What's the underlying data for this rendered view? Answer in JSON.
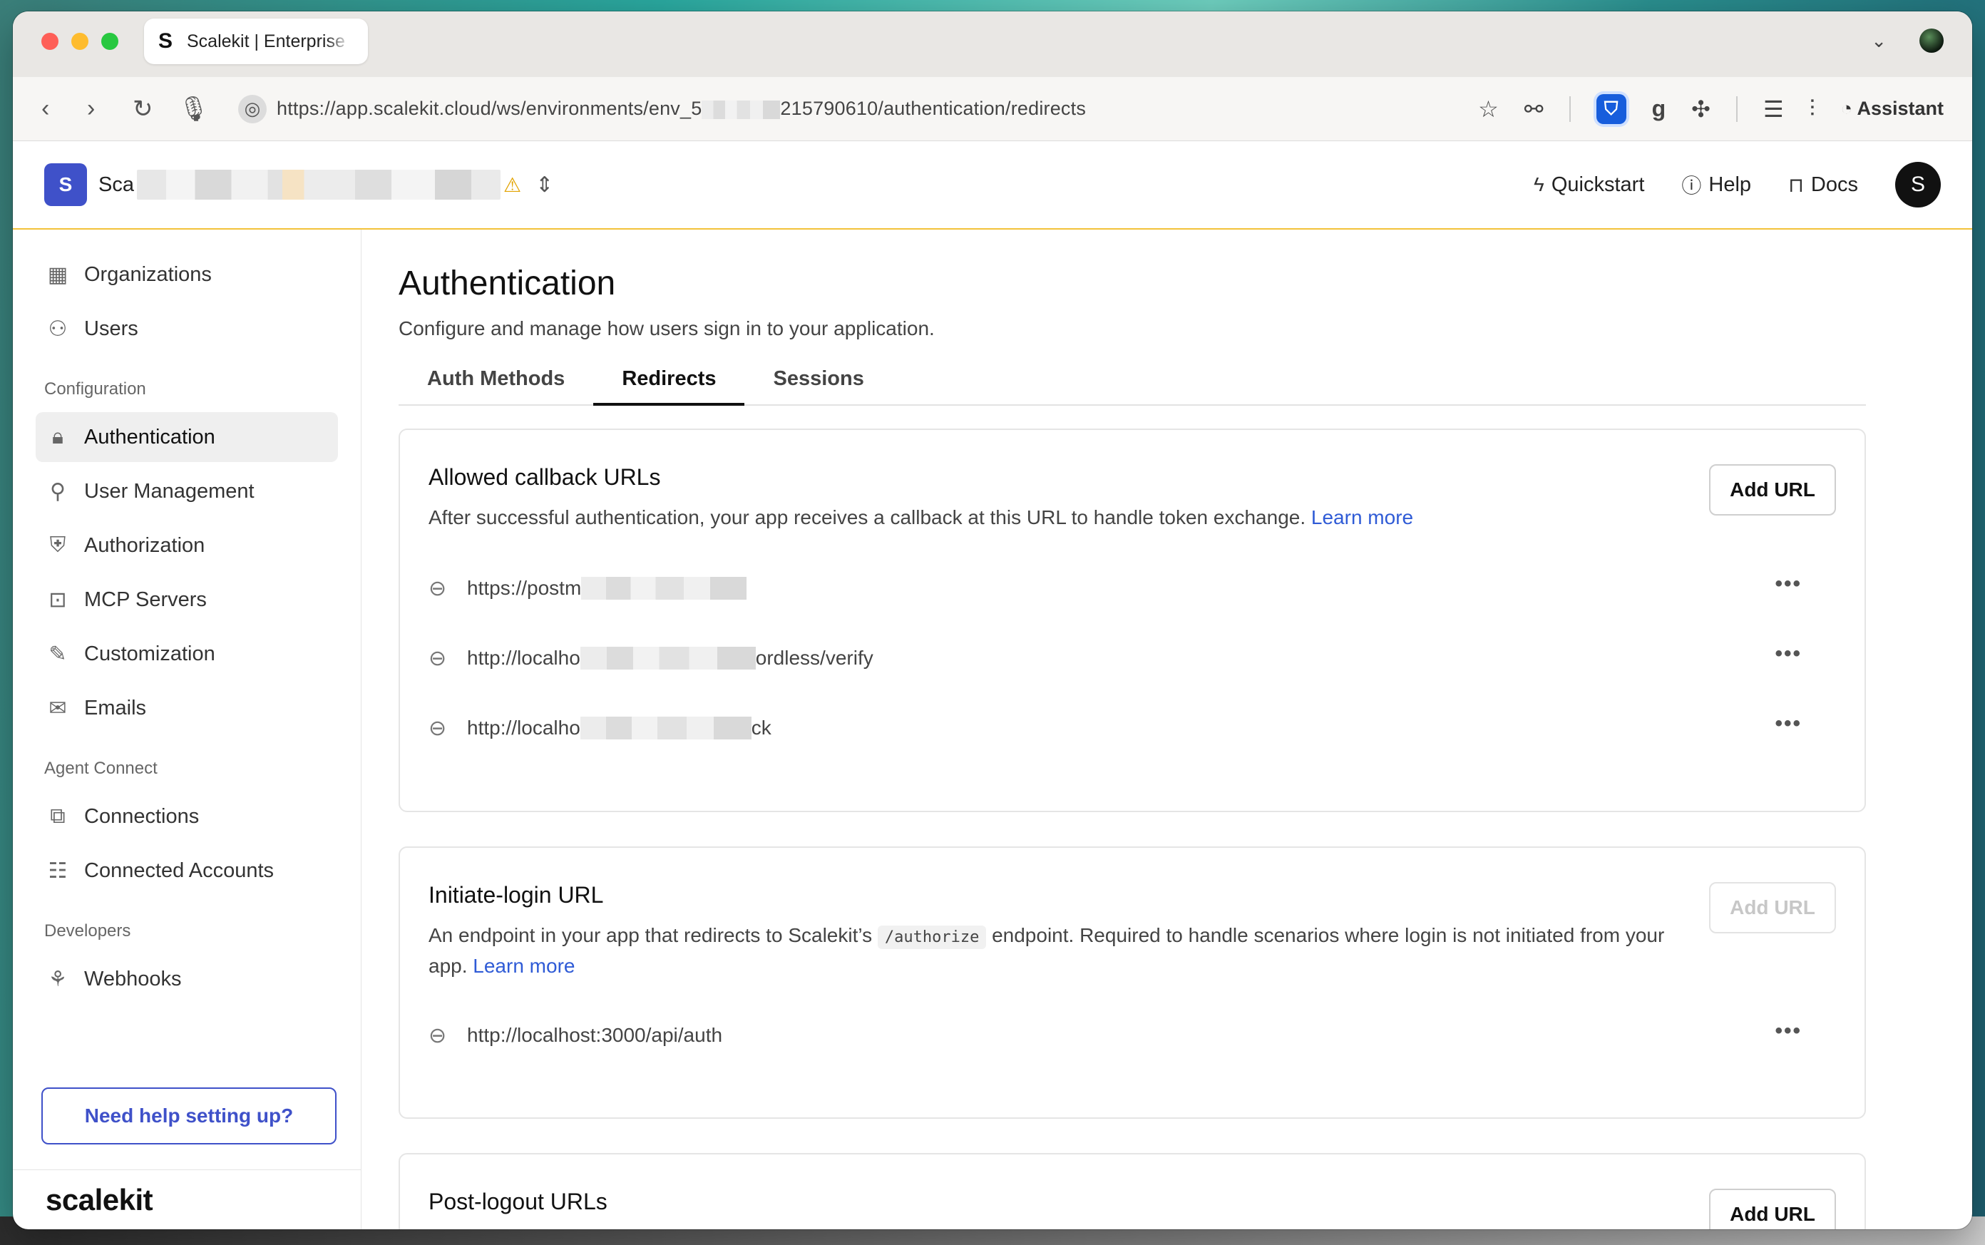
{
  "browser": {
    "tab_title": "Scalekit | Enterprise",
    "tab_favicon": "S",
    "url": "https://app.scalekit.cloud/ws/environments/env_5",
    "url_tail": "215790610/authentication/redirects",
    "assistant_label": "Assistant"
  },
  "header": {
    "workspace_initial": "S",
    "workspace_name": "Sca",
    "links": [
      {
        "label": "Quickstart",
        "icon": "bolt-icon"
      },
      {
        "label": "Help",
        "icon": "help-circle-icon"
      },
      {
        "label": "Docs",
        "icon": "book-icon"
      }
    ],
    "user_initial": "S"
  },
  "sidebar": {
    "items_top": [
      {
        "label": "Organizations",
        "icon": "building-icon"
      },
      {
        "label": "Users",
        "icon": "users-icon"
      }
    ],
    "section_config": "Configuration",
    "items_config": [
      {
        "label": "Authentication",
        "icon": "lock-icon"
      },
      {
        "label": "User Management",
        "icon": "user-settings-icon"
      },
      {
        "label": "Authorization",
        "icon": "shield-check-icon"
      },
      {
        "label": "MCP Servers",
        "icon": "robot-icon"
      },
      {
        "label": "Customization",
        "icon": "brush-icon"
      },
      {
        "label": "Emails",
        "icon": "mail-icon"
      }
    ],
    "section_agent": "Agent Connect",
    "items_agent": [
      {
        "label": "Connections",
        "icon": "blocks-icon"
      },
      {
        "label": "Connected Accounts",
        "icon": "accounts-icon"
      }
    ],
    "section_dev": "Developers",
    "items_dev": [
      {
        "label": "Webhooks",
        "icon": "webhook-icon"
      }
    ],
    "help_button": "Need help setting up?",
    "brand": "scalekit"
  },
  "main": {
    "title": "Authentication",
    "subtitle": "Configure and manage how users sign in to your application.",
    "tabs": [
      "Auth Methods",
      "Redirects",
      "Sessions"
    ],
    "selected_tab": "Redirects",
    "callback": {
      "title": "Allowed callback URLs",
      "desc": "After successful authentication, your app receives a callback at this URL to handle token exchange.",
      "learn_more": "Learn more",
      "add_label": "Add URL",
      "urls": [
        {
          "prefix": "https://postm",
          "suffix": ""
        },
        {
          "prefix": "http://localho",
          "suffix": "ordless/verify"
        },
        {
          "prefix": "http://localho",
          "suffix": "ck"
        }
      ]
    },
    "initiate": {
      "title": "Initiate-login URL",
      "desc_a": "An endpoint in your app that redirects to Scalekit’s",
      "code": "/authorize",
      "desc_b": "endpoint. Required to handle scenarios where login is not initiated from your app.",
      "learn_more": "Learn more",
      "add_label": "Add URL",
      "url": "http://localhost:3000/api/auth"
    },
    "postlogout": {
      "title": "Post-logout URLs",
      "add_label": "Add URL"
    }
  }
}
